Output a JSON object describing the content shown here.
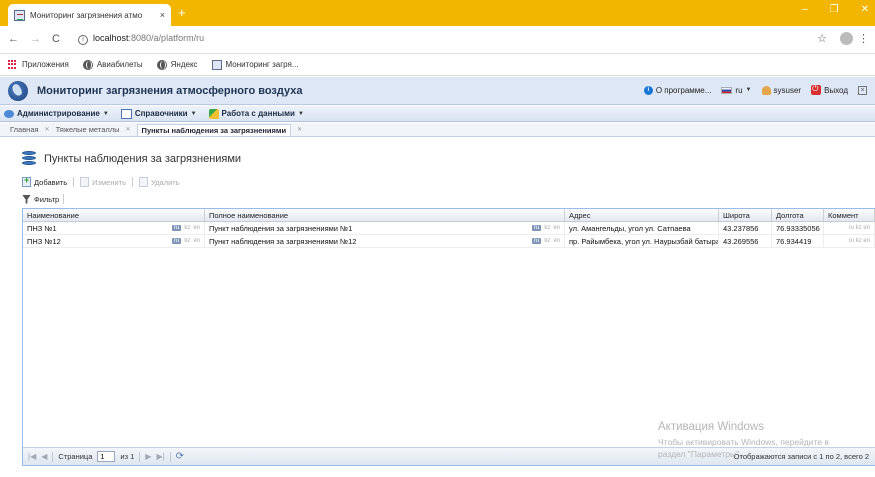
{
  "browser": {
    "tab_title": "Мониторинг загрязнения атмо",
    "tab_close": "×",
    "new_tab": "+",
    "window_buttons": [
      "–",
      "❐",
      "✕"
    ],
    "nav": {
      "back": "←",
      "forward": "→",
      "reload": "C"
    },
    "url_host": "localhost",
    "url_rest": ":8080/a/platform/ru",
    "bookmarks": [
      {
        "label": "Приложения",
        "icon": "apps-icon"
      },
      {
        "label": "Авиабилеты",
        "icon": "globe-icon"
      },
      {
        "label": "Яндекс",
        "icon": "globe-icon"
      },
      {
        "label": "Мониторинг загря...",
        "icon": "app-favicon"
      }
    ]
  },
  "app": {
    "title": "Мониторинг загрязнения атмосферного воздуха",
    "header": {
      "about": "О программе...",
      "lang": "ru",
      "user": "sysuser",
      "logout": "Выход"
    },
    "menu": [
      {
        "label": "Администрирование",
        "icon": "admin-icon"
      },
      {
        "label": "Справочники",
        "icon": "book-icon"
      },
      {
        "label": "Работа с данными",
        "icon": "data-icon"
      }
    ],
    "breadcrumb": [
      "Главная",
      "Тяжелые металлы",
      "Пункты наблюдения за загрязнениями"
    ]
  },
  "page": {
    "title": "Пункты наблюдения за загрязнениями",
    "toolbar": {
      "add": "Добавить",
      "edit": "Изменить",
      "delete": "Удалить",
      "filter": "Фильтр"
    }
  },
  "grid": {
    "columns": [
      "Наименование",
      "Полное наименование",
      "Адрес",
      "Широта",
      "Долгота",
      "Коммент"
    ],
    "lang_badges": [
      "ru",
      "kz",
      "en"
    ],
    "rows": [
      {
        "name": "ПНЗ №1",
        "full_name": "Пункт наблюдения за загрязнениями №1",
        "address": "ул. Амангельды, угол ул. Сатпаева",
        "lat": "43.237856",
        "lon": "76.93335056"
      },
      {
        "name": "ПНЗ №12",
        "full_name": "Пункт наблюдения за загрязнениями №12",
        "address": "пр. Райымбека, угол ул. Наурызбай батыра",
        "lat": "43.269556",
        "lon": "76.934419"
      }
    ]
  },
  "pager": {
    "page_label": "Страница",
    "page_value": "1",
    "of_label": "из 1",
    "summary": "Отображаются записи с 1 по 2, всего 2"
  },
  "watermark": {
    "line1": "Активация Windows",
    "line2": "Чтобы активировать Windows, перейдите в",
    "line3": "раздел \"Параметры\"."
  }
}
